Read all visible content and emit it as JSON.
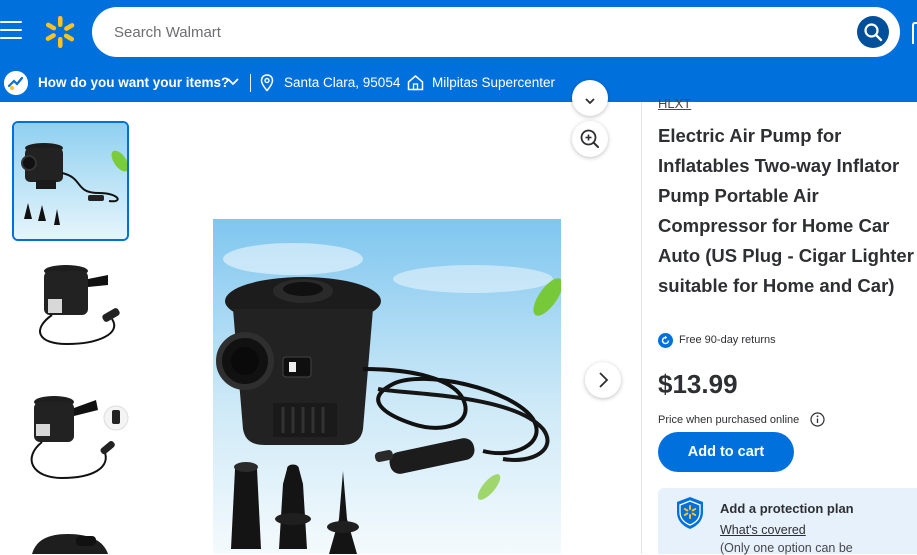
{
  "header": {
    "search_placeholder": "Search Walmart",
    "accent_color": "#0071dc",
    "spark_color": "#ffc220"
  },
  "subbar": {
    "intent_label": "How do you want your items?",
    "location": "Santa Clara, 95054",
    "store": "Milpitas Supercenter"
  },
  "product": {
    "brand": "HLXT",
    "title": "Electric Air Pump for Inflatables Two-way Inflator Pump Portable Air Compressor for Home Car Auto (US Plug - Cigar Lighter suitable for Home and Car)",
    "returns_text": "Free 90-day returns",
    "price": "$13.99",
    "price_note": "Price when purchased online",
    "add_to_cart_label": "Add to cart"
  },
  "protection": {
    "title": "Add a protection plan",
    "link": "What's covered",
    "note": "(Only one option can be"
  },
  "gallery": {
    "thumbnails": [
      "air-pump-thumb-1",
      "air-pump-thumb-2",
      "air-pump-thumb-3",
      "air-pump-thumb-4"
    ],
    "active_index": 0,
    "icons": [
      "zoom-in-icon",
      "next-arrow-icon",
      "menu-icon",
      "spark-logo-icon",
      "search-icon"
    ]
  }
}
